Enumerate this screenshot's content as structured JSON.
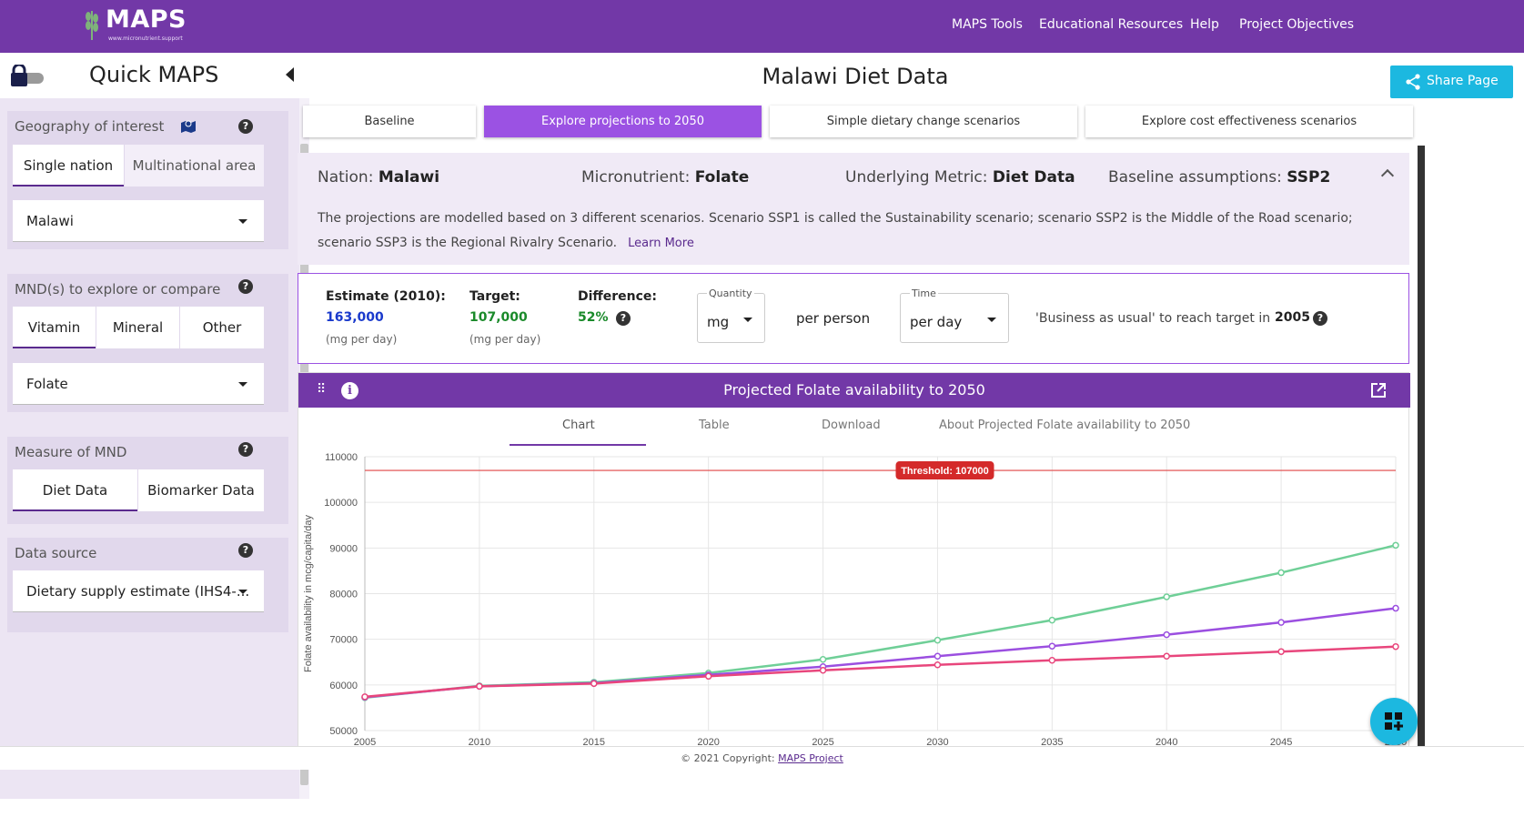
{
  "topbar": {
    "logo_text": "MAPS",
    "logo_sub": "www.micronutrient.support",
    "nav": [
      "MAPS Tools",
      "Educational Resources",
      "Help",
      "Project Objectives"
    ]
  },
  "sidebar": {
    "title": "Quick MAPS",
    "geography": {
      "label": "Geography of interest",
      "options": [
        "Single nation",
        "Multinational area"
      ],
      "selected": "Malawi"
    },
    "mnd": {
      "label": "MND(s) to explore or compare",
      "options": [
        "Vitamin",
        "Mineral",
        "Other"
      ],
      "selected": "Folate"
    },
    "measure": {
      "label": "Measure of MND",
      "options": [
        "Diet Data",
        "Biomarker Data"
      ]
    },
    "source": {
      "label": "Data source",
      "selected": "Dietary supply estimate (IHS4-..."
    }
  },
  "main": {
    "title": "Malawi Diet Data",
    "share_label": "Share Page",
    "tabs": [
      "Baseline",
      "Explore projections to 2050",
      "Simple dietary change scenarios",
      "Explore cost effectiveness scenarios"
    ],
    "info": {
      "nation_label": "Nation:",
      "nation": "Malawi",
      "micro_label": "Micronutrient:",
      "micro": "Folate",
      "metric_label": "Underlying Metric:",
      "metric": "Diet Data",
      "baseline_label": "Baseline assumptions:",
      "baseline": "SSP2",
      "description": "The projections are modelled based on 3 different scenarios. Scenario SSP1 is called the Sustainability scenario; scenario SSP2 is the Middle of the Road scenario; scenario SSP3 is the Regional Rivalry Scenario.",
      "learn_more": "Learn More"
    },
    "stats": {
      "estimate_label": "Estimate (2010):",
      "estimate": "163,000",
      "estimate_unit": "(mg per day)",
      "target_label": "Target:",
      "target": "107,000",
      "target_unit": "(mg per day)",
      "diff_label": "Difference:",
      "diff": "52%",
      "quantity_label": "Quantity",
      "quantity": "mg",
      "per_person": "per person",
      "time_label": "Time",
      "time": "per day",
      "bau_label": "'Business as usual' to reach target in",
      "bau_year": "2005"
    },
    "chart_card": {
      "title": "Projected Folate availability to 2050",
      "tabs": [
        "Chart",
        "Table",
        "Download",
        "About Projected Folate availability to 2050"
      ]
    }
  },
  "chart_data": {
    "type": "line",
    "x": [
      2005,
      2010,
      2015,
      2020,
      2025,
      2030,
      2035,
      2040,
      2045,
      2050
    ],
    "series": [
      {
        "color": "#6fcf97",
        "values": [
          57200,
          59800,
          60600,
          62600,
          65600,
          69800,
          74200,
          79300,
          84600,
          90600
        ]
      },
      {
        "color": "#9b4fe0",
        "values": [
          57300,
          59700,
          60400,
          62200,
          64000,
          66300,
          68500,
          71000,
          73700,
          76800
        ]
      },
      {
        "color": "#e8467c",
        "values": [
          57400,
          59700,
          60300,
          61900,
          63200,
          64400,
          65400,
          66300,
          67300,
          68400
        ]
      }
    ],
    "threshold": {
      "value": 107000,
      "label": "Threshold: 107000",
      "color": "#e04646"
    },
    "ylabel": "Folate availability in mcg/capita/day",
    "ylim": [
      50000,
      110000
    ],
    "yticks": [
      50000,
      60000,
      70000,
      80000,
      90000,
      100000,
      110000
    ],
    "grid": true
  },
  "footer": {
    "text": "© 2021 Copyright:",
    "link": "MAPS Project"
  }
}
